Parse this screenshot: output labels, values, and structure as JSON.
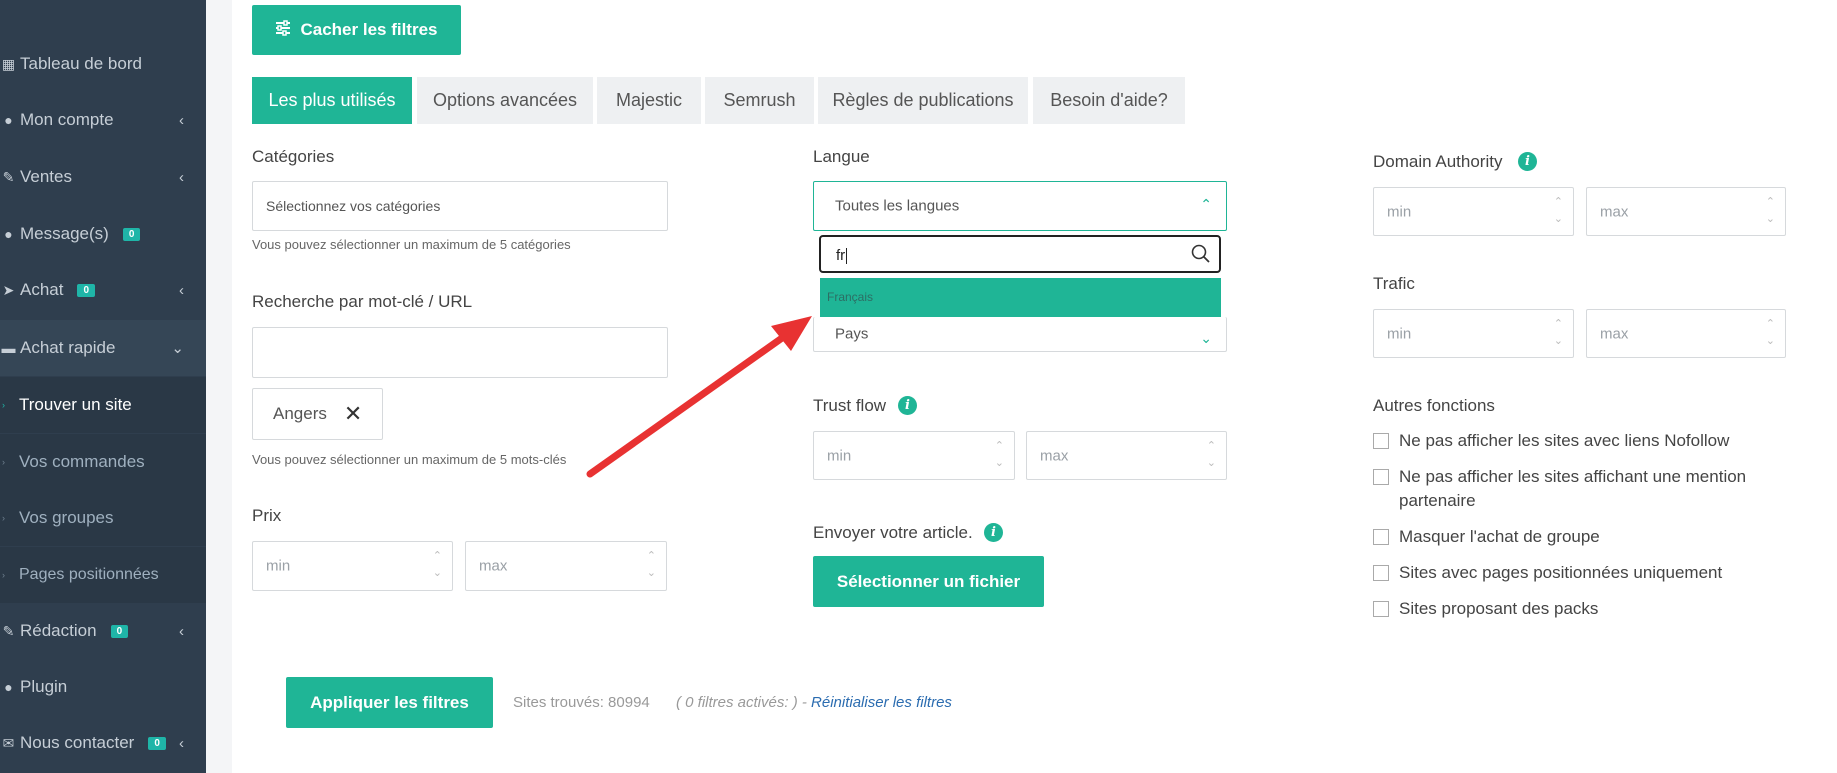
{
  "sidebar": {
    "items": [
      {
        "label": "Tableau de bord",
        "icon": "grid-icon",
        "badge": "",
        "chevron": ""
      },
      {
        "label": "Mon compte",
        "icon": "user-icon",
        "badge": "",
        "chevron": "‹"
      },
      {
        "label": "Ventes",
        "icon": "edit-icon",
        "badge": "",
        "chevron": "‹"
      },
      {
        "label": "Message(s)",
        "icon": "chat-icon",
        "badge": "0",
        "chevron": ""
      },
      {
        "label": "Achat",
        "icon": "send-icon",
        "badge": "0",
        "chevron": "‹"
      },
      {
        "label": "Achat rapide",
        "icon": "cart-icon",
        "badge": "",
        "chevron": "⌄"
      }
    ],
    "subitems": [
      {
        "label": "Trouver un site"
      },
      {
        "label": "Vos commandes"
      },
      {
        "label": "Vos groupes"
      },
      {
        "label": "Pages positionnées"
      }
    ],
    "bottom_items": [
      {
        "label": "Rédaction",
        "icon": "pencil-icon",
        "badge": "0",
        "chevron": "‹"
      },
      {
        "label": "Plugin",
        "icon": "globe-icon",
        "badge": "",
        "chevron": ""
      },
      {
        "label": "Nous contacter",
        "icon": "mail-icon",
        "badge": "0",
        "chevron": "‹"
      }
    ]
  },
  "toolbar": {
    "hide_filters_label": "Cacher les filtres"
  },
  "tabs": [
    {
      "label": "Les plus utilisés"
    },
    {
      "label": "Options avancées"
    },
    {
      "label": "Majestic"
    },
    {
      "label": "Semrush"
    },
    {
      "label": "Règles de publications"
    },
    {
      "label": "Besoin d'aide?"
    }
  ],
  "left_col": {
    "categories_label": "Catégories",
    "categories_placeholder": "Sélectionnez vos catégories",
    "categories_hint": "Vous pouvez sélectionner un maximum de 5 catégories",
    "keyword_label": "Recherche par mot-clé / URL",
    "keyword_value": "",
    "tag_value": "Angers",
    "tag_remove": "✕",
    "keyword_hint": "Vous pouvez sélectionner un maximum de 5 mots-clés",
    "price_label": "Prix",
    "min_placeholder": "min",
    "max_placeholder": "max"
  },
  "mid_col": {
    "language_label": "Langue",
    "language_value": "Toutes les langues",
    "language_search_value": "fr",
    "language_option": "Français",
    "country_value": "Pays",
    "trustflow_label": "Trust flow",
    "min_placeholder": "min",
    "max_placeholder": "max",
    "send_article_label": "Envoyer votre article.",
    "select_file_label": "Sélectionner un fichier"
  },
  "right_col": {
    "da_label": "Domain Authority",
    "traffic_label": "Trafic",
    "min_placeholder": "min",
    "max_placeholder": "max",
    "other_label": "Autres fonctions",
    "checkboxes": [
      {
        "label": "Ne pas afficher les sites avec liens Nofollow",
        "checked": false
      },
      {
        "label": "Ne pas afficher les sites affichant une mention partenaire",
        "checked": false
      },
      {
        "label": "Masquer l'achat de groupe",
        "checked": false
      },
      {
        "label": "Sites avec pages positionnées uniquement",
        "checked": false
      },
      {
        "label": "Sites proposant des packs",
        "checked": false
      }
    ]
  },
  "footer": {
    "apply_label": "Appliquer les filtres",
    "sites_found": "Sites trouvés: 80994",
    "filters_active": "( 0 filtres activés: ) - ",
    "reset_label": "Réinitialiser les filtres"
  },
  "colors": {
    "accent": "#1fb596",
    "sidebar": "#2f3e4e",
    "arrow": "#e83232"
  }
}
